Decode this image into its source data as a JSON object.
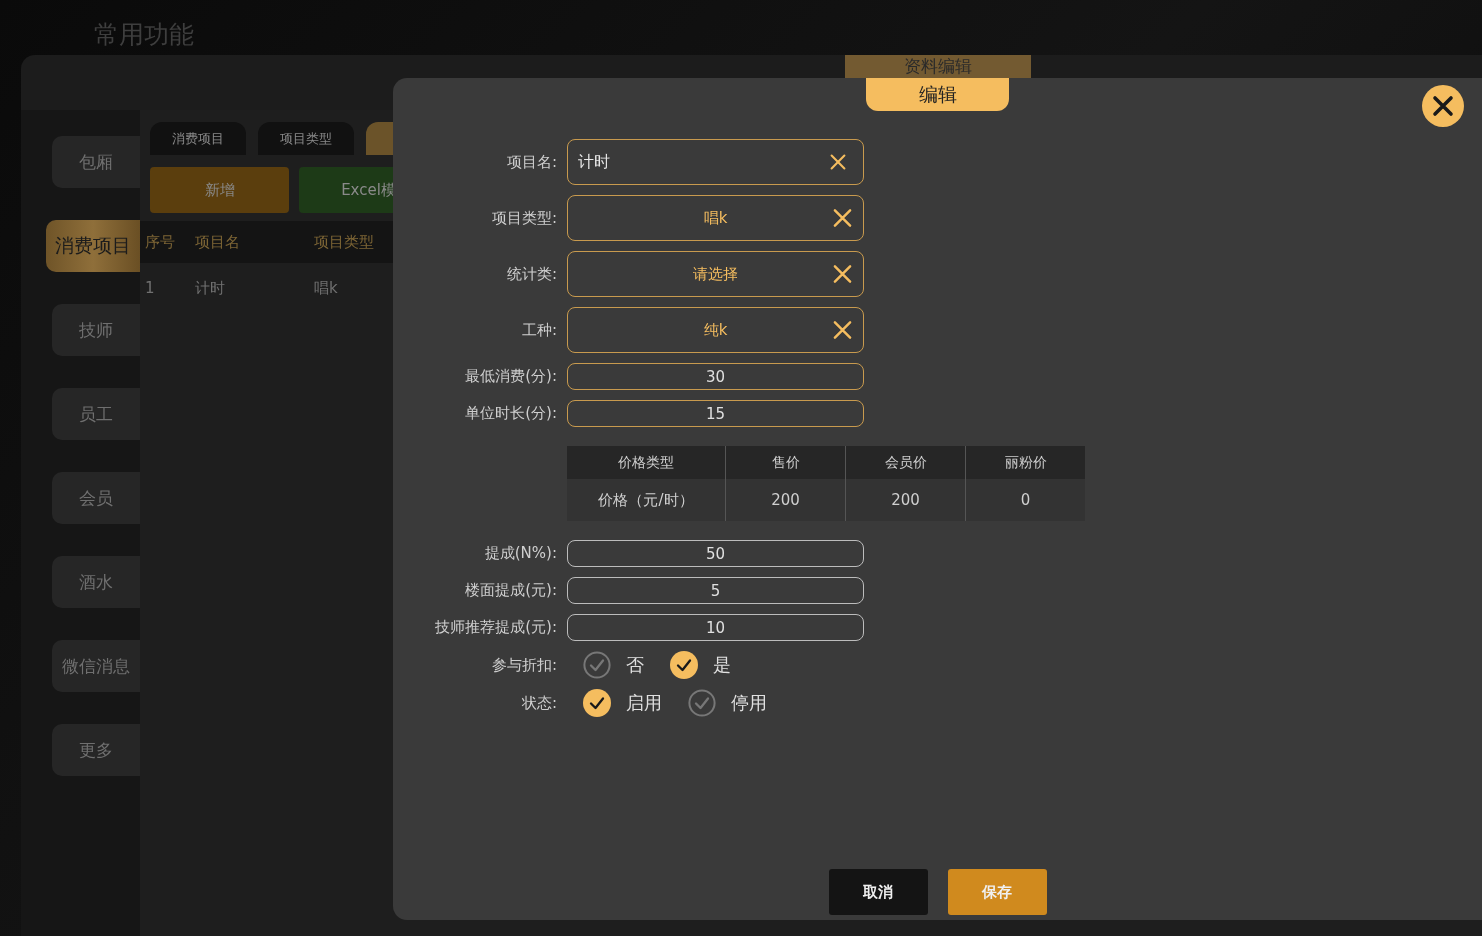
{
  "page_title": "常用功能",
  "sidebar": {
    "items": [
      {
        "label": "包厢",
        "selected": false
      },
      {
        "label": "消费项目",
        "selected": true
      },
      {
        "label": "技师",
        "selected": false
      },
      {
        "label": "员工",
        "selected": false
      },
      {
        "label": "会员",
        "selected": false
      },
      {
        "label": "酒水",
        "selected": false
      },
      {
        "label": "微信消息",
        "selected": false
      },
      {
        "label": "更多",
        "selected": false
      }
    ]
  },
  "tabs": [
    {
      "label": "消费项目",
      "selected": false
    },
    {
      "label": "项目类型",
      "selected": false
    },
    {
      "selected": true
    }
  ],
  "toolbar": {
    "buttons": [
      {
        "label": "新增",
        "kind": "add"
      },
      {
        "label": "Excel模",
        "kind": "excel"
      }
    ]
  },
  "table": {
    "columns": [
      "序号",
      "项目名",
      "项目类型"
    ],
    "rows": [
      [
        "1",
        "计时",
        "唱k"
      ]
    ]
  },
  "dialog": {
    "back_tab": "资料编辑",
    "title": "编辑",
    "fields": [
      {
        "label": "项目名:",
        "kind": "text",
        "value": "计时"
      },
      {
        "label": "项目类型:",
        "kind": "select",
        "value": "唱k"
      },
      {
        "label": "统计类:",
        "kind": "select",
        "placeholder": "请选择"
      },
      {
        "label": "工种:",
        "kind": "select",
        "value": "纯k"
      },
      {
        "label": "最低消费(分):",
        "kind": "number",
        "value": "30"
      },
      {
        "label": "单位时长(分):",
        "kind": "number",
        "value": "15"
      }
    ],
    "price_table": {
      "columns": [
        "价格类型",
        "售价",
        "会员价",
        "丽粉价"
      ],
      "rows": [
        [
          "价格（元/时）",
          "200",
          "200",
          "0"
        ]
      ]
    },
    "more_fields": [
      {
        "label": "提成(N%):",
        "kind": "plain",
        "value": "50"
      },
      {
        "label": "楼面提成(元):",
        "kind": "plain",
        "value": "5"
      },
      {
        "label": "技师推荐提成(元):",
        "kind": "plain",
        "value": "10"
      }
    ],
    "options": [
      {
        "label": "参与折扣:",
        "choices": [
          {
            "label": "否",
            "selected": false
          },
          {
            "label": "是",
            "selected": true
          }
        ]
      },
      {
        "label": "状态:",
        "choices": [
          {
            "label": "启用",
            "selected": true
          },
          {
            "label": "停用",
            "selected": false
          }
        ]
      }
    ],
    "buttons": [
      {
        "label": "取消",
        "kind": "cancel"
      },
      {
        "label": "保存",
        "kind": "save"
      }
    ]
  }
}
